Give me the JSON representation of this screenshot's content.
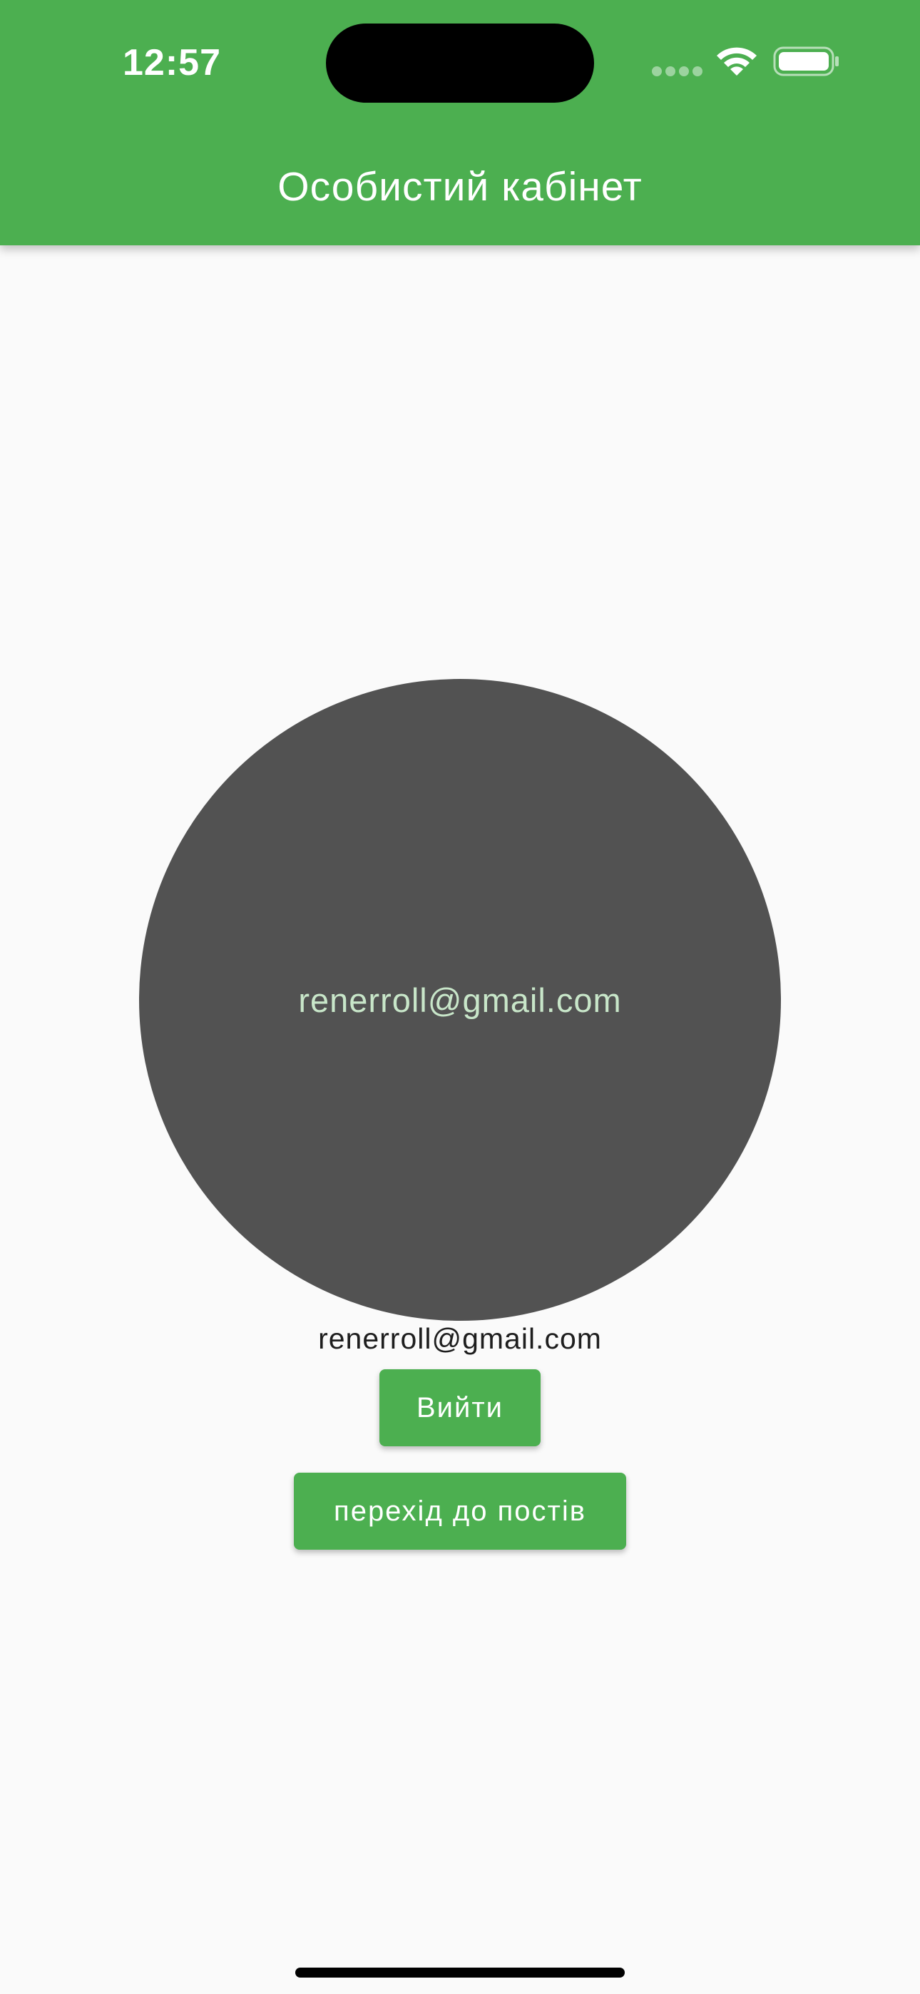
{
  "status_bar": {
    "time": "12:57"
  },
  "app_bar": {
    "title": "Особистий кабінет"
  },
  "profile": {
    "avatar_text": "renerroll@gmail.com",
    "email": "renerroll@gmail.com"
  },
  "actions": {
    "logout_label": "Вийти",
    "posts_label": "перехід до постів"
  },
  "colors": {
    "primary": "#4caf50",
    "background": "#fafafa",
    "avatar_bg": "#525252",
    "avatar_text": "#c8e6c9"
  },
  "icons": {
    "signal": "cellular-signal-icon",
    "wifi": "wifi-icon",
    "battery": "battery-icon"
  }
}
